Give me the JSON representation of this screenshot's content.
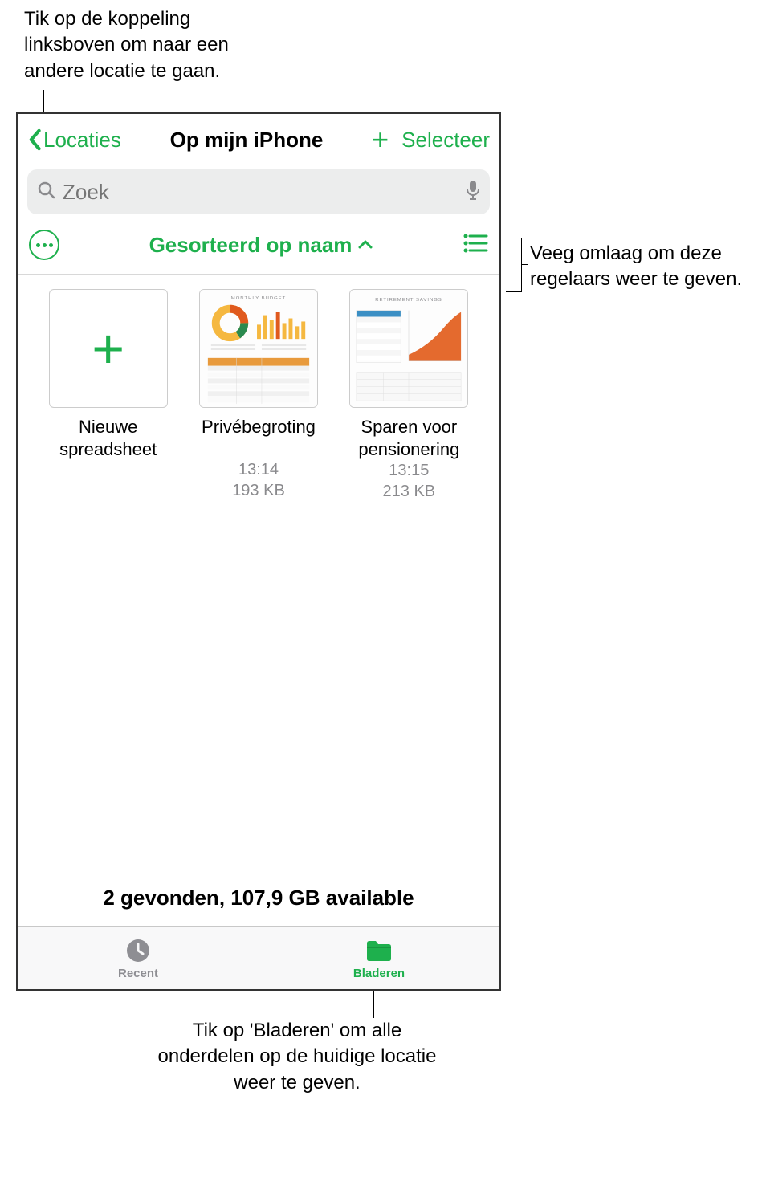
{
  "callouts": {
    "top": "Tik op de koppeling linksboven om naar een andere locatie te gaan.",
    "right": "Veeg omlaag om deze regelaars weer te geven.",
    "bottom": "Tik op 'Bladeren' om alle onderdelen op de huidige locatie weer te geven."
  },
  "navbar": {
    "back_label": "Locaties",
    "title": "Op mijn iPhone",
    "select_label": "Selecteer"
  },
  "search": {
    "placeholder": "Zoek"
  },
  "sort": {
    "label": "Gesorteerd op naam"
  },
  "grid": {
    "new_label": "Nieuwe spreadsheet",
    "items": [
      {
        "name": "Privébegroting",
        "time": "13:14",
        "size": "193 KB"
      },
      {
        "name": "Sparen voor pensionering",
        "time": "13:15",
        "size": "213 KB"
      }
    ]
  },
  "footer": {
    "status": "2 gevonden, 107,9 GB available"
  },
  "tabbar": {
    "recent_label": "Recent",
    "browse_label": "Bladeren"
  },
  "doc_thumbnails": {
    "budget_title": "MONTHLY BUDGET",
    "retirement_title": "RETIREMENT SAVINGS"
  }
}
